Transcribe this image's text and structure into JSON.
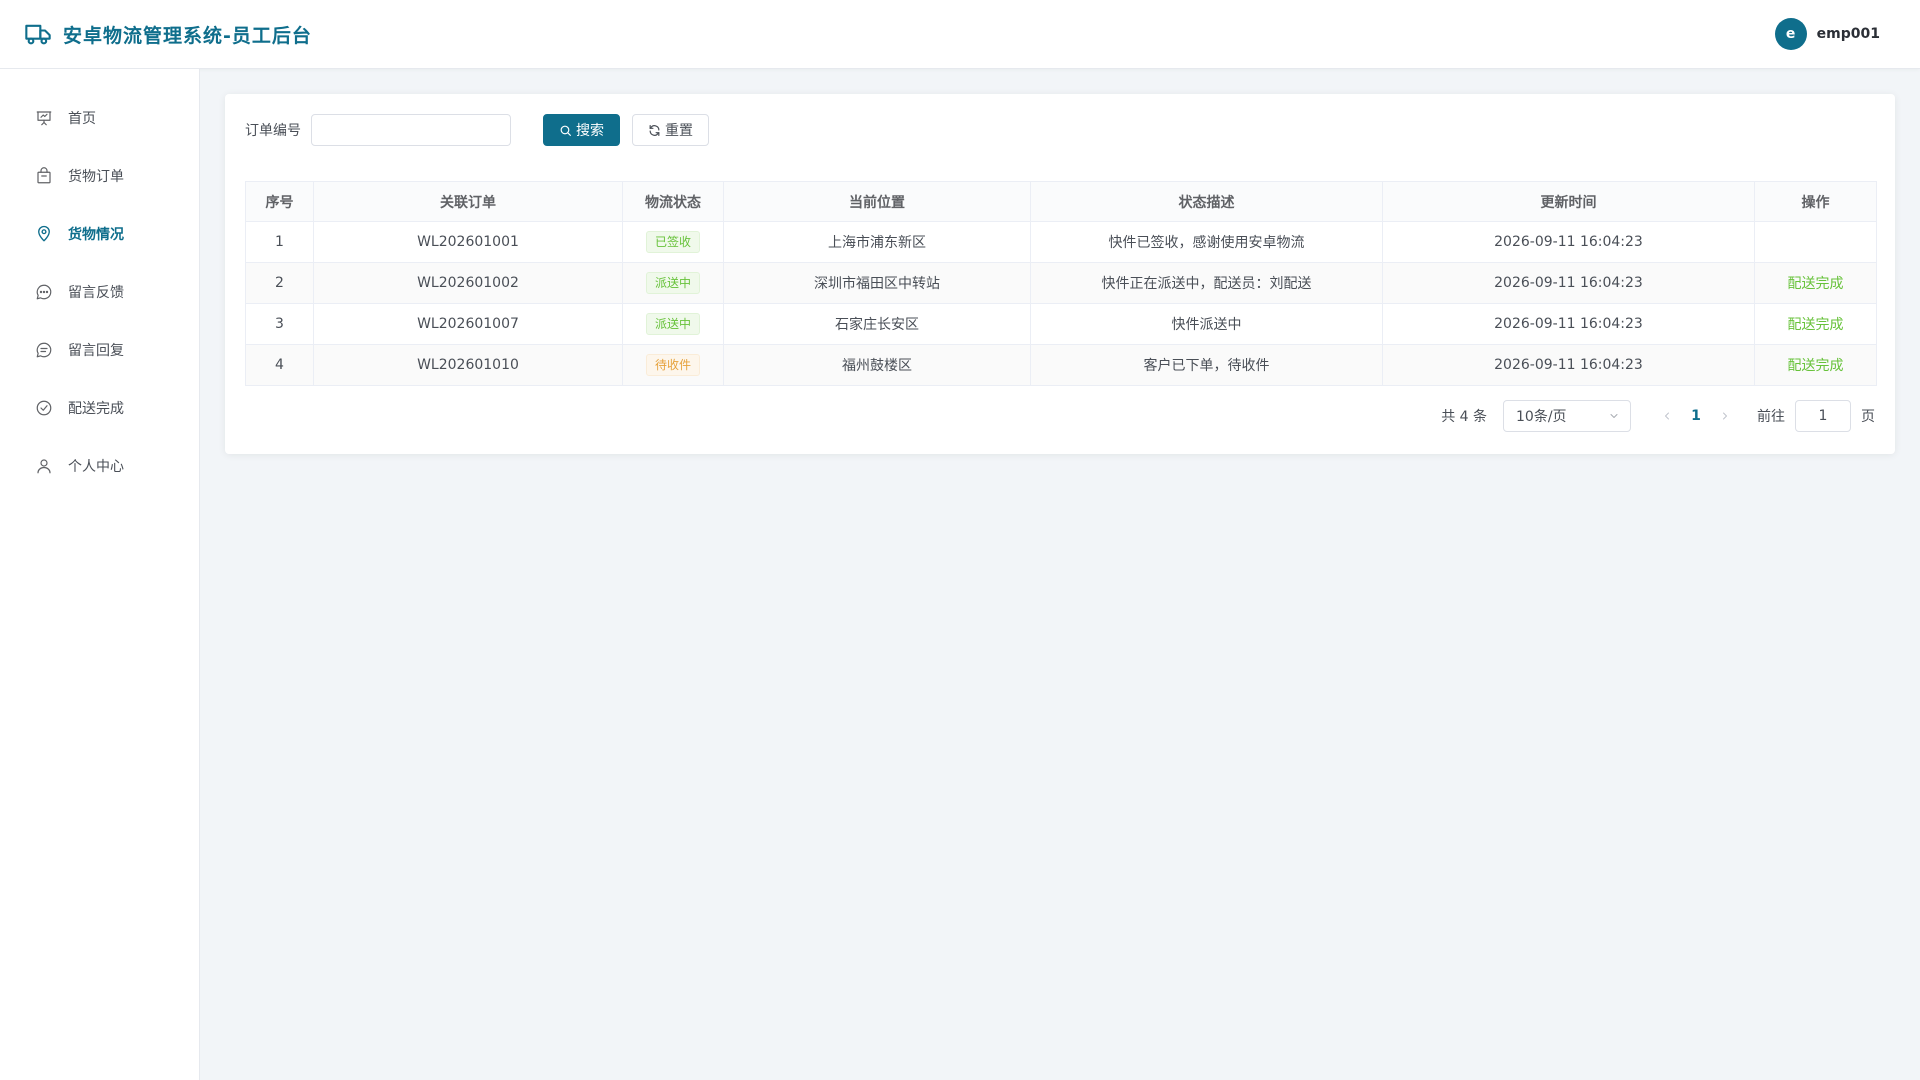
{
  "header": {
    "title": "安卓物流管理系统-员工后台",
    "avatar_letter": "e",
    "username": "emp001"
  },
  "sidebar": {
    "items": [
      {
        "label": "首页",
        "icon": "presentation-icon"
      },
      {
        "label": "货物订单",
        "icon": "package-icon"
      },
      {
        "label": "货物情况",
        "icon": "location-pin-icon",
        "active": true
      },
      {
        "label": "留言反馈",
        "icon": "chat-dots-icon"
      },
      {
        "label": "留言回复",
        "icon": "chat-lines-icon"
      },
      {
        "label": "配送完成",
        "icon": "circle-check-icon"
      },
      {
        "label": "个人中心",
        "icon": "user-icon"
      }
    ]
  },
  "search": {
    "label": "订单编号",
    "value": "",
    "placeholder": "",
    "search_button": "搜索",
    "reset_button": "重置"
  },
  "table": {
    "columns": [
      "序号",
      "关联订单",
      "物流状态",
      "当前位置",
      "状态描述",
      "更新时间",
      "操作"
    ],
    "rows": [
      {
        "index": "1",
        "order": "WL202601001",
        "status": "已签收",
        "status_type": "success",
        "location": "上海市浦东新区",
        "desc": "快件已签收，感谢使用安卓物流",
        "time": "2026-09-11 16:04:23",
        "action": ""
      },
      {
        "index": "2",
        "order": "WL202601002",
        "status": "派送中",
        "status_type": "success",
        "location": "深圳市福田区中转站",
        "desc": "快件正在派送中，配送员：刘配送",
        "time": "2026-09-11 16:04:23",
        "action": "配送完成"
      },
      {
        "index": "3",
        "order": "WL202601007",
        "status": "派送中",
        "status_type": "success",
        "location": "石家庄长安区",
        "desc": "快件派送中",
        "time": "2026-09-11 16:04:23",
        "action": "配送完成"
      },
      {
        "index": "4",
        "order": "WL202601010",
        "status": "待收件",
        "status_type": "warning",
        "location": "福州鼓楼区",
        "desc": "客户已下单，待收件",
        "time": "2026-09-11 16:04:23",
        "action": "配送完成"
      }
    ]
  },
  "pagination": {
    "total": "共 4 条",
    "page_size": "10条/页",
    "current_page": "1",
    "goto_label": "前往",
    "goto_value": "1",
    "page_unit": "页"
  },
  "colors": {
    "brand": "#0f6e8c",
    "success": "#67c23a",
    "warning": "#e6a23c",
    "background": "#f2f5f8"
  }
}
